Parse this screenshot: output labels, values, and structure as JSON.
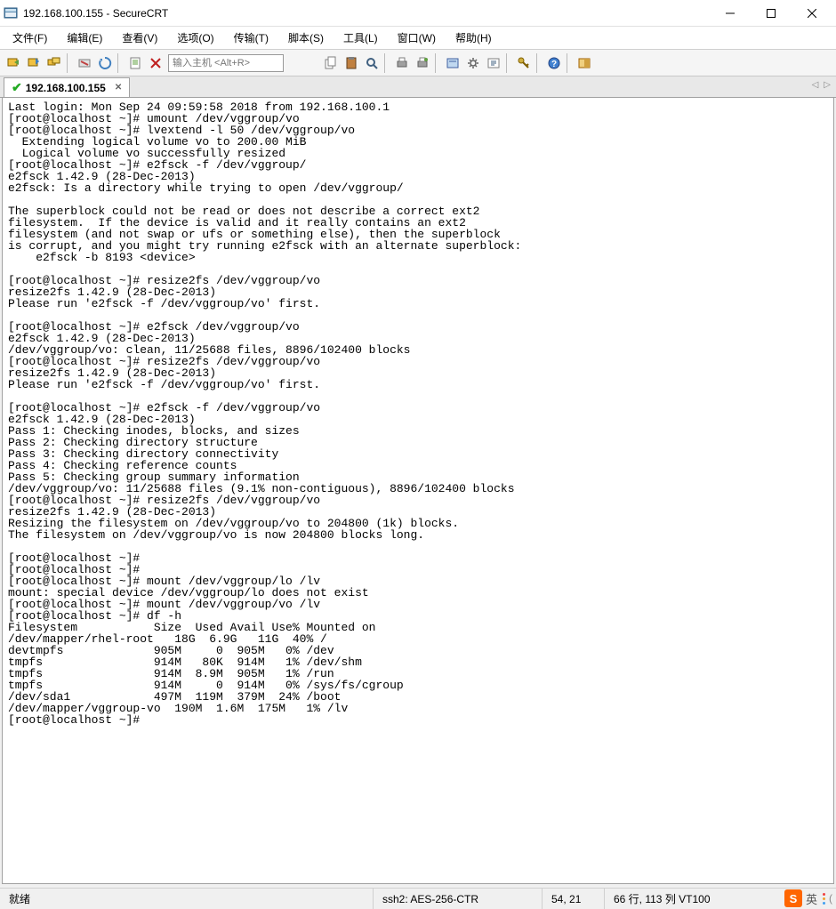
{
  "window": {
    "title": "192.168.100.155 - SecureCRT"
  },
  "menu": {
    "file": "文件(F)",
    "edit": "编辑(E)",
    "view": "查看(V)",
    "options": "选项(O)",
    "transfer": "传输(T)",
    "script": "脚本(S)",
    "tools": "工具(L)",
    "window": "窗口(W)",
    "help": "帮助(H)"
  },
  "toolbar": {
    "host_placeholder": "输入主机 <Alt+R>"
  },
  "tab": {
    "label": "192.168.100.155"
  },
  "terminal_lines": [
    "Last login: Mon Sep 24 09:59:58 2018 from 192.168.100.1",
    "[root@localhost ~]# umount /dev/vggroup/vo",
    "[root@localhost ~]# lvextend -l 50 /dev/vggroup/vo",
    "  Extending logical volume vo to 200.00 MiB",
    "  Logical volume vo successfully resized",
    "[root@localhost ~]# e2fsck -f /dev/vggroup/",
    "e2fsck 1.42.9 (28-Dec-2013)",
    "e2fsck: Is a directory while trying to open /dev/vggroup/",
    "",
    "The superblock could not be read or does not describe a correct ext2",
    "filesystem.  If the device is valid and it really contains an ext2",
    "filesystem (and not swap or ufs or something else), then the superblock",
    "is corrupt, and you might try running e2fsck with an alternate superblock:",
    "    e2fsck -b 8193 <device>",
    "",
    "[root@localhost ~]# resize2fs /dev/vggroup/vo",
    "resize2fs 1.42.9 (28-Dec-2013)",
    "Please run 'e2fsck -f /dev/vggroup/vo' first.",
    "",
    "[root@localhost ~]# e2fsck /dev/vggroup/vo",
    "e2fsck 1.42.9 (28-Dec-2013)",
    "/dev/vggroup/vo: clean, 11/25688 files, 8896/102400 blocks",
    "[root@localhost ~]# resize2fs /dev/vggroup/vo",
    "resize2fs 1.42.9 (28-Dec-2013)",
    "Please run 'e2fsck -f /dev/vggroup/vo' first.",
    "",
    "[root@localhost ~]# e2fsck -f /dev/vggroup/vo",
    "e2fsck 1.42.9 (28-Dec-2013)",
    "Pass 1: Checking inodes, blocks, and sizes",
    "Pass 2: Checking directory structure",
    "Pass 3: Checking directory connectivity",
    "Pass 4: Checking reference counts",
    "Pass 5: Checking group summary information",
    "/dev/vggroup/vo: 11/25688 files (9.1% non-contiguous), 8896/102400 blocks",
    "[root@localhost ~]# resize2fs /dev/vggroup/vo",
    "resize2fs 1.42.9 (28-Dec-2013)",
    "Resizing the filesystem on /dev/vggroup/vo to 204800 (1k) blocks.",
    "The filesystem on /dev/vggroup/vo is now 204800 blocks long.",
    "",
    "[root@localhost ~]#",
    "[root@localhost ~]#",
    "[root@localhost ~]# mount /dev/vggroup/lo /lv",
    "mount: special device /dev/vggroup/lo does not exist",
    "[root@localhost ~]# mount /dev/vggroup/vo /lv",
    "[root@localhost ~]# df -h",
    "Filesystem           Size  Used Avail Use% Mounted on",
    "/dev/mapper/rhel-root   18G  6.9G   11G  40% /",
    "devtmpfs             905M     0  905M   0% /dev",
    "tmpfs                914M   80K  914M   1% /dev/shm",
    "tmpfs                914M  8.9M  905M   1% /run",
    "tmpfs                914M     0  914M   0% /sys/fs/cgroup",
    "/dev/sda1            497M  119M  379M  24% /boot",
    "/dev/mapper/vggroup-vo  190M  1.6M  175M   1% /lv",
    "[root@localhost ~]#"
  ],
  "status": {
    "ready": "就绪",
    "proto": "ssh2: AES-256-CTR",
    "cursor": "54,  21",
    "size": "66 行, 113 列 VT100"
  },
  "ime": {
    "label": "英"
  }
}
